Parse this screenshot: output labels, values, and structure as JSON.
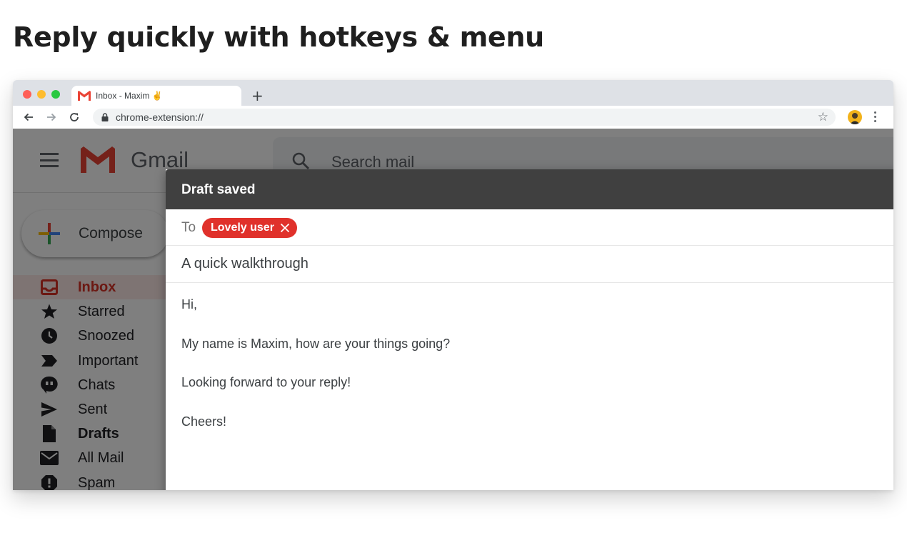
{
  "headline": "Reply quickly with hotkeys & menu",
  "browser": {
    "tab_title": "Inbox - Maxim ✌️",
    "new_tab": "+",
    "url": "chrome-extension://"
  },
  "gmail": {
    "wordmark": "Gmail",
    "search_placeholder": "Search mail",
    "compose_label": "Compose",
    "nav": [
      {
        "label": "Inbox",
        "icon": "inbox-icon"
      },
      {
        "label": "Starred",
        "icon": "star-icon"
      },
      {
        "label": "Snoozed",
        "icon": "clock-icon"
      },
      {
        "label": "Important",
        "icon": "important-icon"
      },
      {
        "label": "Chats",
        "icon": "chat-icon"
      },
      {
        "label": "Sent",
        "icon": "send-icon"
      },
      {
        "label": "Drafts",
        "icon": "draft-icon"
      },
      {
        "label": "All Mail",
        "icon": "mail-icon"
      },
      {
        "label": "Spam",
        "icon": "spam-icon"
      }
    ]
  },
  "compose": {
    "header": "Draft saved",
    "to_label": "To",
    "recipient": "Lovely user",
    "subject": "A quick walkthrough",
    "body": [
      "Hi,",
      "My name is Maxim, how are your things going?",
      "Looking forward to your reply!",
      "Cheers!"
    ]
  },
  "colors": {
    "chip": "#e0312b",
    "compose_header": "#404040",
    "active_nav": "#d93025"
  }
}
